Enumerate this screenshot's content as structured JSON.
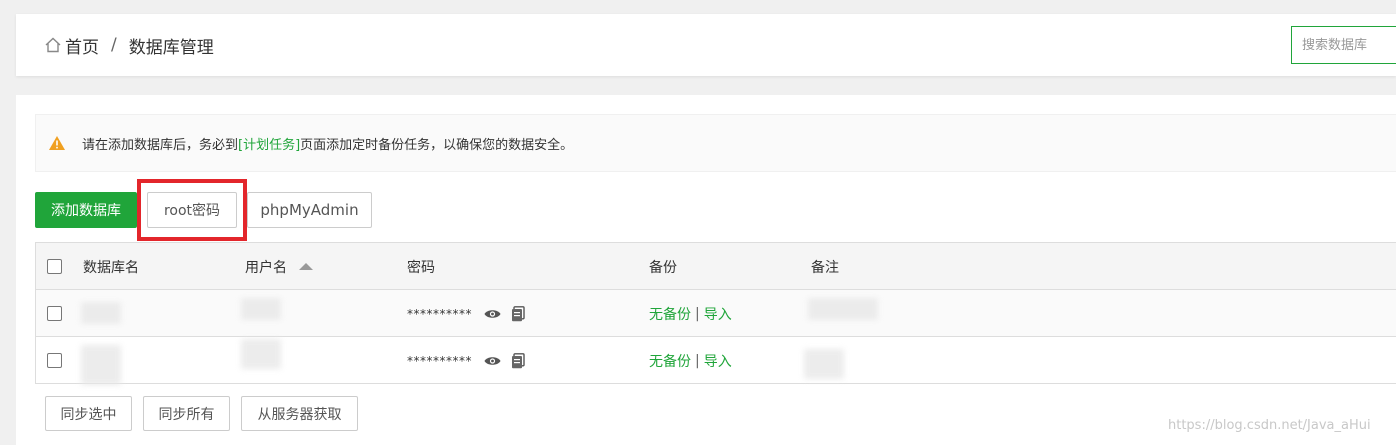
{
  "breadcrumb": {
    "home": "首页",
    "separator": "/",
    "current": "数据库管理"
  },
  "search": {
    "placeholder": "搜索数据库"
  },
  "alert": {
    "before": "请在添加数据库后，务必到",
    "link": "[计划任务]",
    "after": "页面添加定时备份任务，以确保您的数据安全。"
  },
  "toolbar": {
    "add_label": "添加数据库",
    "root_label": "root密码",
    "pma_label": "phpMyAdmin"
  },
  "table": {
    "headers": {
      "name": "数据库名",
      "user": "用户名",
      "password": "密码",
      "backup": "备份",
      "note": "备注"
    },
    "rows": [
      {
        "password": "**********",
        "backup": "无备份",
        "sep": "|",
        "import": "导入"
      },
      {
        "password": "**********",
        "backup": "无备份",
        "sep": "|",
        "import": "导入"
      }
    ]
  },
  "bottom": {
    "sync_selected": "同步选中",
    "sync_all": "同步所有",
    "fetch_server": "从服务器获取"
  },
  "watermark": "https://blog.csdn.net/Java_aHui",
  "colors": {
    "accent": "#20a53a",
    "highlight": "#e3262b",
    "warning": "#f0a020"
  }
}
